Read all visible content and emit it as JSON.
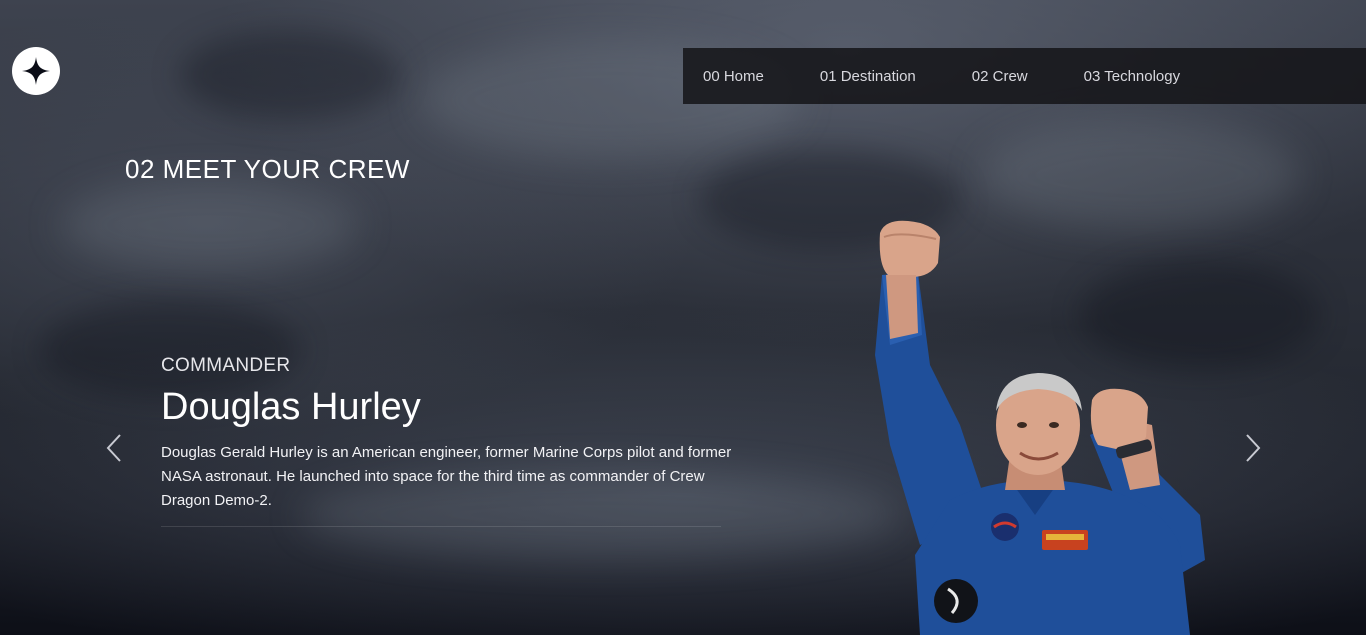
{
  "header": {
    "logo_icon": "star-logo-icon",
    "nav": [
      {
        "number": "00",
        "label": "Home",
        "text": "00 Home"
      },
      {
        "number": "01",
        "label": "Destination",
        "text": "01 Destination"
      },
      {
        "number": "02",
        "label": "Crew",
        "text": "02 Crew"
      },
      {
        "number": "03",
        "label": "Technology",
        "text": "03 Technology"
      }
    ]
  },
  "main": {
    "page_title": "02 MEET YOUR CREW",
    "crew": {
      "role": "COMMANDER",
      "name": "Douglas Hurley",
      "bio": "Douglas Gerald Hurley is an American engineer, former Marine Corps pilot and former NASA astronaut. He launched into space for the third time as commander of Crew Dragon Demo-2."
    },
    "carousel": {
      "prev_icon": "chevron-left-icon",
      "next_icon": "chevron-right-icon"
    }
  },
  "colors": {
    "background": "#0b0d17",
    "text": "#ffffff",
    "nav_bg": "#141418",
    "suit_blue": "#1f4f9a"
  }
}
